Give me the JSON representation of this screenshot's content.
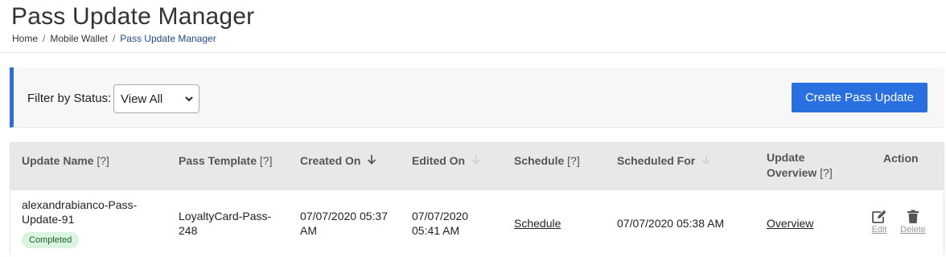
{
  "page": {
    "title": "Pass Update Manager",
    "breadcrumb": [
      "Home",
      "Mobile Wallet",
      "Pass Update Manager"
    ]
  },
  "filter": {
    "label": "Filter by Status:",
    "selected": "View All",
    "create_button": "Create Pass Update"
  },
  "table": {
    "columns": {
      "update_name": "Update Name",
      "update_name_help": "[?]",
      "pass_template": "Pass Template",
      "pass_template_help": "[?]",
      "created_on": "Created On",
      "edited_on": "Edited On",
      "schedule": "Schedule",
      "schedule_help": "[?]",
      "scheduled_for": "Scheduled For",
      "update_overview_line1": "Update",
      "update_overview_line2": "Overview",
      "update_overview_help": "[?]",
      "action": "Action"
    },
    "rows": [
      {
        "update_name_line1": "alexandrabianco-Pass-",
        "update_name_line2": "Update-91",
        "status": "Completed",
        "pass_template_line1": "LoyaltyCard-Pass-",
        "pass_template_line2": "248",
        "created_on_line1": "07/07/2020 05:37",
        "created_on_line2": "AM",
        "edited_on_line1": "07/07/2020",
        "edited_on_line2": "05:41 AM",
        "schedule": "Schedule",
        "scheduled_for": "07/07/2020 05:38 AM",
        "overview": "Overview",
        "edit": "Edit",
        "delete": "Delete"
      }
    ]
  },
  "icons": {
    "sort_active": "arrow-down-icon",
    "sort_inactive": "arrow-down-icon",
    "edit": "edit-icon",
    "delete": "trash-icon",
    "select": "chevron-down-icon"
  },
  "colors": {
    "accent": "#2a6fe0",
    "filter_border": "#2d6fd6",
    "badge_bg": "#d9f5df",
    "breadcrumb_current": "#1f4a8a"
  }
}
